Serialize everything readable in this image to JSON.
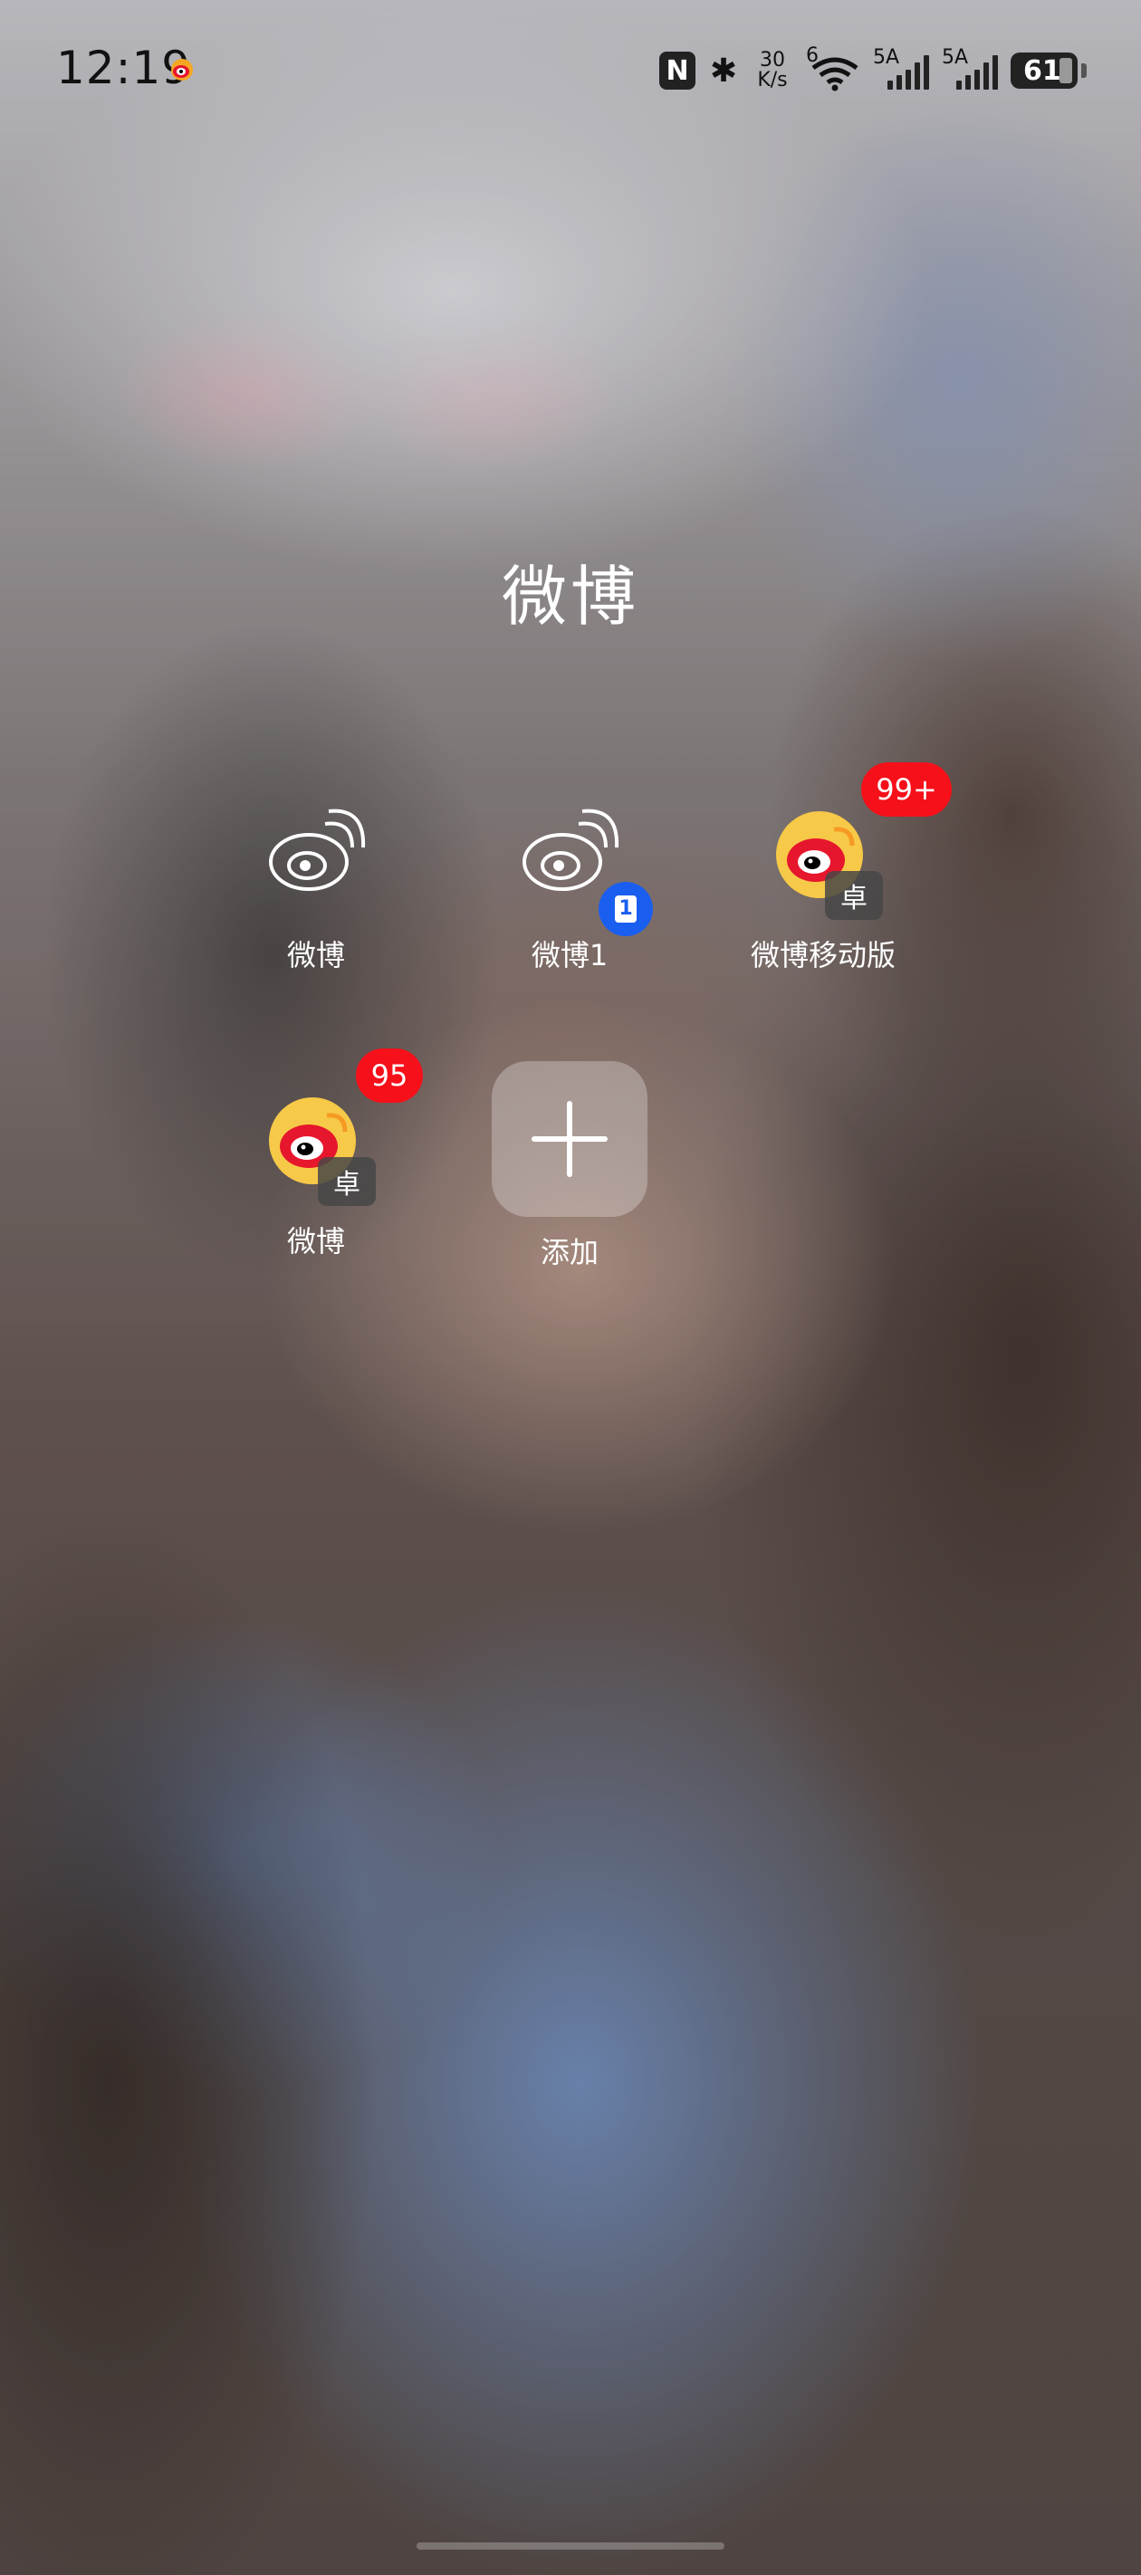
{
  "status_bar": {
    "time": "12:19",
    "network_speed_value": "30",
    "network_speed_unit": "K/s",
    "wifi_label": "6",
    "sim1_label": "5A",
    "sim2_label": "5A",
    "battery_level": "61",
    "icons": [
      "weibo-notification-icon",
      "nfc-icon",
      "bluetooth-icon",
      "wifi-icon",
      "signal-icon",
      "signal-icon",
      "battery-icon"
    ]
  },
  "folder": {
    "title": "微博",
    "apps": [
      {
        "label": "微博",
        "icon": "weibo-outline-icon"
      },
      {
        "label": "微博1",
        "icon": "weibo-outline-icon",
        "clone_badge": "1"
      },
      {
        "label": "微博移动版",
        "icon": "weibo-color-icon",
        "badge": "99+",
        "tag": "卓"
      },
      {
        "label": "微博",
        "icon": "weibo-color-icon",
        "badge": "95",
        "tag": "卓"
      }
    ],
    "add_label": "添加"
  },
  "colors": {
    "badge_red": "#f5101a",
    "badge_blue": "#1a5ef0"
  }
}
